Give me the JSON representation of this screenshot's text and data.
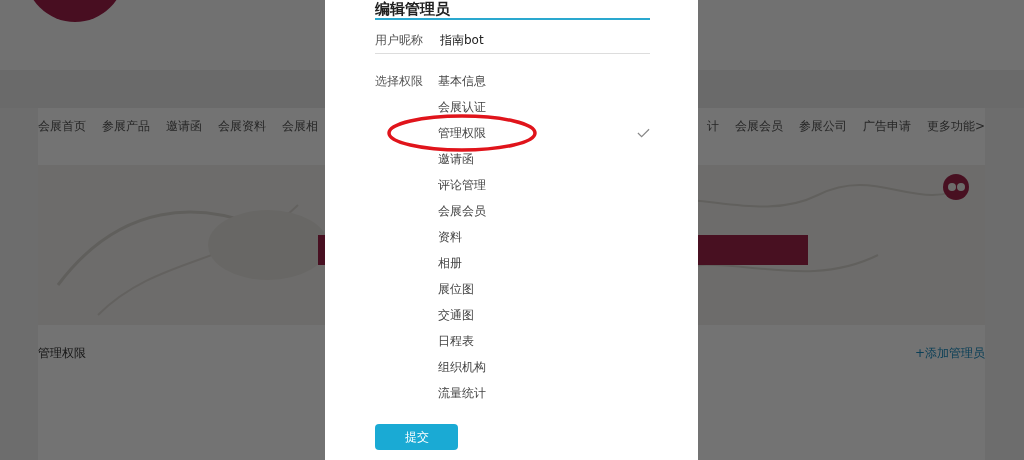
{
  "background_page": {
    "nav_left": [
      "会展首页",
      "参展产品",
      "邀请函",
      "会展资料",
      "会展相"
    ],
    "nav_right": [
      "计",
      "会展会员",
      "参展公司",
      "广告申请",
      "更多功能>"
    ],
    "section_title": "管理权限",
    "add_link": "+添加管理员"
  },
  "dialog": {
    "title": "编辑管理员",
    "nickname": {
      "label": "用户昵称",
      "value": "指南bot"
    },
    "permissions_label": "选择权限",
    "permissions": [
      {
        "label": "基本信息",
        "checked": false
      },
      {
        "label": "会展认证",
        "checked": false
      },
      {
        "label": "管理权限",
        "checked": true
      },
      {
        "label": "邀请函",
        "checked": false
      },
      {
        "label": "评论管理",
        "checked": false
      },
      {
        "label": "会展会员",
        "checked": false
      },
      {
        "label": "资料",
        "checked": false
      },
      {
        "label": "相册",
        "checked": false
      },
      {
        "label": "展位图",
        "checked": false
      },
      {
        "label": "交通图",
        "checked": false
      },
      {
        "label": "日程表",
        "checked": false
      },
      {
        "label": "组织机构",
        "checked": false
      },
      {
        "label": "流量统计",
        "checked": false
      }
    ],
    "submit": "提交"
  }
}
